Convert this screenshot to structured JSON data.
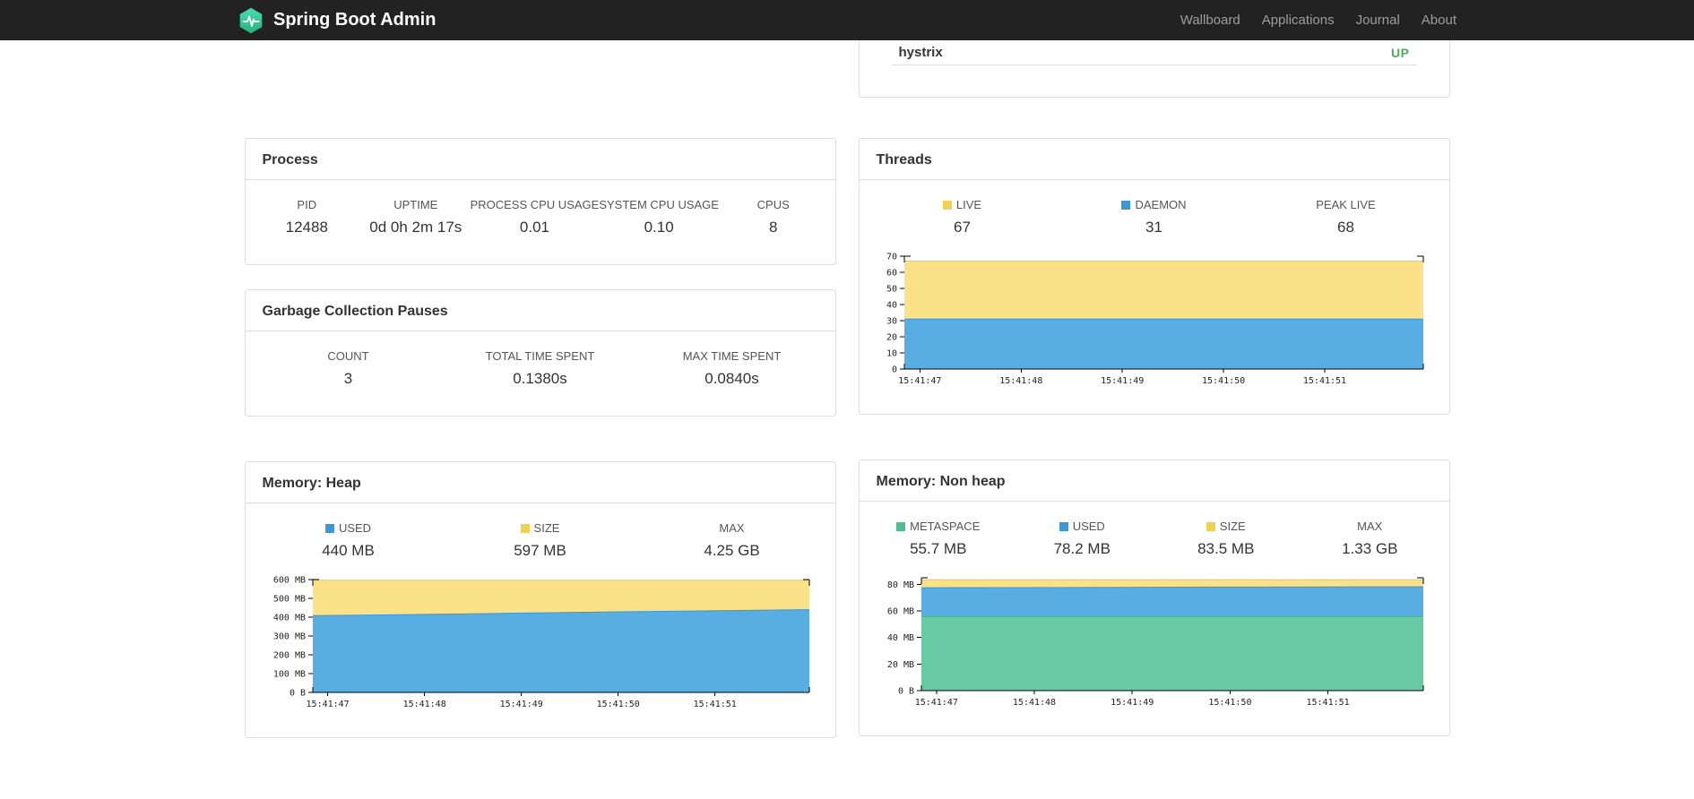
{
  "navbar": {
    "brand": "Spring Boot Admin",
    "links": [
      {
        "label": "Wallboard"
      },
      {
        "label": "Applications"
      },
      {
        "label": "Journal"
      },
      {
        "label": "About"
      }
    ]
  },
  "application_status": {
    "name": "hystrix",
    "status": "UP",
    "status_color": "#4caf50"
  },
  "panels": {
    "process": {
      "title": "Process",
      "stats": [
        {
          "label": "PID",
          "value": "12488"
        },
        {
          "label": "UPTIME",
          "value": "0d 0h 2m 17s"
        },
        {
          "label": "PROCESS CPU USAGE",
          "value": "0.01"
        },
        {
          "label": "SYSTEM CPU USAGE",
          "value": "0.10"
        },
        {
          "label": "CPUS",
          "value": "8"
        }
      ]
    },
    "gc": {
      "title": "Garbage Collection Pauses",
      "stats": [
        {
          "label": "COUNT",
          "value": "3"
        },
        {
          "label": "TOTAL TIME SPENT",
          "value": "0.1380s"
        },
        {
          "label": "MAX TIME SPENT",
          "value": "0.0840s"
        }
      ]
    },
    "threads": {
      "title": "Threads",
      "stats": [
        {
          "label": "LIVE",
          "value": "67",
          "swatch": "#f0d24f"
        },
        {
          "label": "DAEMON",
          "value": "31",
          "swatch": "#3e97d4"
        },
        {
          "label": "PEAK LIVE",
          "value": "68"
        }
      ]
    },
    "heap": {
      "title": "Memory: Heap",
      "stats": [
        {
          "label": "USED",
          "value": "440 MB",
          "swatch": "#3e97d4"
        },
        {
          "label": "SIZE",
          "value": "597 MB",
          "swatch": "#f0d24f"
        },
        {
          "label": "MAX",
          "value": "4.25 GB"
        }
      ]
    },
    "nonheap": {
      "title": "Memory: Non heap",
      "stats": [
        {
          "label": "METASPACE",
          "value": "55.7 MB",
          "swatch": "#4cbd92"
        },
        {
          "label": "USED",
          "value": "78.2 MB",
          "swatch": "#3e97d4"
        },
        {
          "label": "SIZE",
          "value": "83.5 MB",
          "swatch": "#f0d24f"
        },
        {
          "label": "MAX",
          "value": "1.33 GB"
        }
      ]
    }
  },
  "chart_data": [
    {
      "id": "threads",
      "type": "area",
      "title": "Threads",
      "ylim": [
        0,
        70
      ],
      "yticks": [
        {
          "value": 70,
          "label": "70"
        },
        {
          "value": 60,
          "label": "60"
        },
        {
          "value": 50,
          "label": "50"
        },
        {
          "value": 40,
          "label": "40"
        },
        {
          "value": 30,
          "label": "30"
        },
        {
          "value": 20,
          "label": "20"
        },
        {
          "value": 10,
          "label": "10"
        },
        {
          "value": 0,
          "label": "0"
        }
      ],
      "x_labels": [
        "15:41:47",
        "15:41:48",
        "15:41:49",
        "15:41:50",
        "15:41:51"
      ],
      "xtick_fractions": [
        0.03,
        0.225,
        0.42,
        0.615,
        0.81
      ],
      "series": [
        {
          "name": "live",
          "values": [
            67,
            67,
            67,
            67,
            67,
            67
          ],
          "fill": "#fbe187",
          "stroke": "#e9c94f"
        },
        {
          "name": "daemon",
          "values": [
            31,
            31,
            31,
            31,
            31,
            31
          ],
          "fill": "#58ade3",
          "stroke": "#3e97d4"
        }
      ]
    },
    {
      "id": "heap",
      "type": "area",
      "title": "Memory: Heap",
      "ylim": [
        0,
        600
      ],
      "yticks": [
        {
          "value": 600,
          "label": "600 MB"
        },
        {
          "value": 500,
          "label": "500 MB"
        },
        {
          "value": 400,
          "label": "400 MB"
        },
        {
          "value": 300,
          "label": "300 MB"
        },
        {
          "value": 200,
          "label": "200 MB"
        },
        {
          "value": 100,
          "label": "100 MB"
        },
        {
          "value": 0,
          "label": "0 B"
        }
      ],
      "x_labels": [
        "15:41:47",
        "15:41:48",
        "15:41:49",
        "15:41:50",
        "15:41:51"
      ],
      "xtick_fractions": [
        0.03,
        0.225,
        0.42,
        0.615,
        0.81
      ],
      "series": [
        {
          "name": "size",
          "values": [
            597,
            597,
            597,
            597,
            597,
            597
          ],
          "fill": "#fbe187",
          "stroke": "#e9c94f"
        },
        {
          "name": "used",
          "values": [
            408,
            414,
            421,
            428,
            434,
            440
          ],
          "fill": "#58ade3",
          "stroke": "#3e97d4"
        }
      ]
    },
    {
      "id": "nonheap",
      "type": "area",
      "title": "Memory: Non heap",
      "ylim": [
        0,
        85
      ],
      "yticks": [
        {
          "value": 80,
          "label": "80 MB"
        },
        {
          "value": 60,
          "label": "60 MB"
        },
        {
          "value": 40,
          "label": "40 MB"
        },
        {
          "value": 20,
          "label": "20 MB"
        },
        {
          "value": 0,
          "label": "0 B"
        }
      ],
      "x_labels": [
        "15:41:47",
        "15:41:48",
        "15:41:49",
        "15:41:50",
        "15:41:51"
      ],
      "xtick_fractions": [
        0.03,
        0.225,
        0.42,
        0.615,
        0.81
      ],
      "series": [
        {
          "name": "size",
          "values": [
            83.5,
            83.5,
            83.5,
            83.5,
            83.5,
            83.5
          ],
          "fill": "#fbe187",
          "stroke": "#e9c94f"
        },
        {
          "name": "used",
          "values": [
            77.5,
            77.6,
            77.8,
            78.0,
            78.1,
            78.2
          ],
          "fill": "#58ade3",
          "stroke": "#3e97d4"
        },
        {
          "name": "metaspace",
          "values": [
            55.7,
            55.7,
            55.7,
            55.7,
            55.7,
            55.7
          ],
          "fill": "#68caa5",
          "stroke": "#46b58c"
        }
      ]
    }
  ]
}
